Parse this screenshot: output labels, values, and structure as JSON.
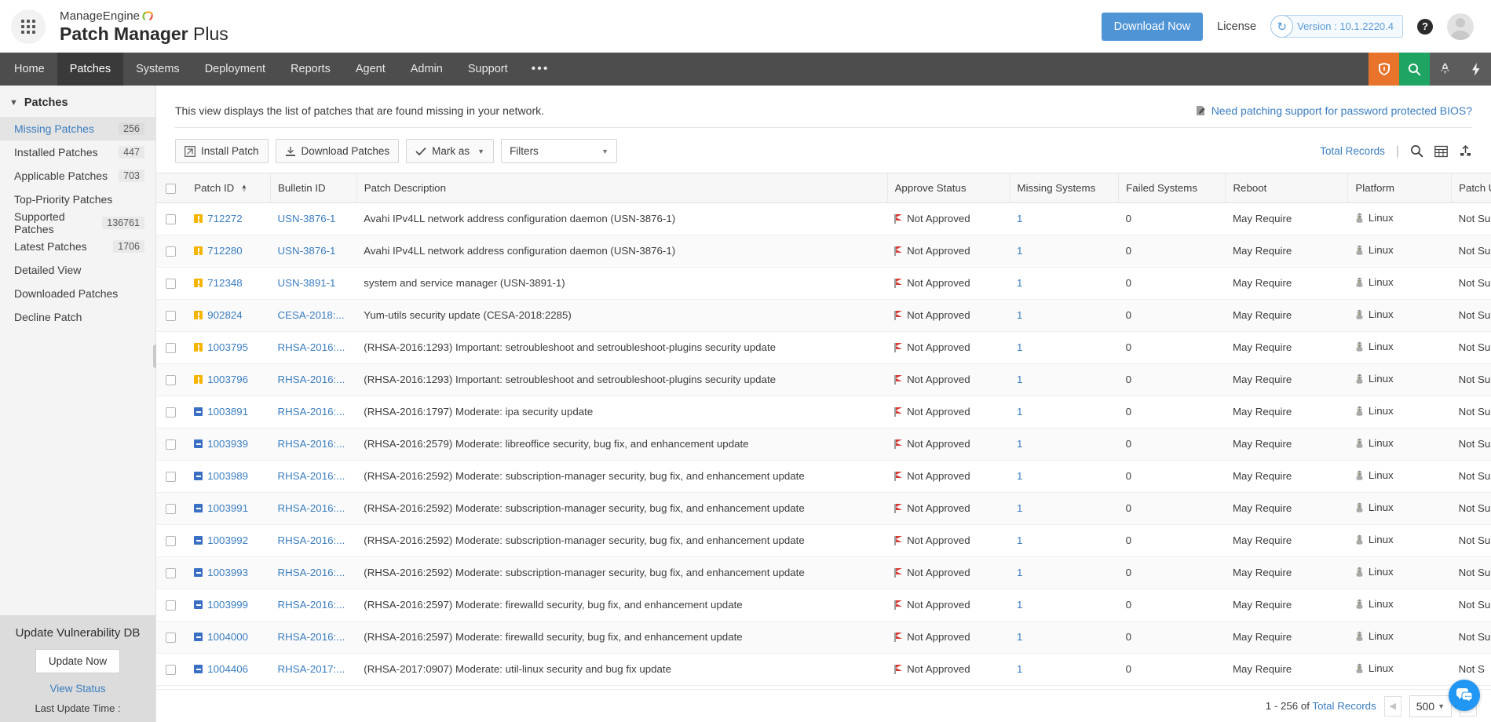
{
  "header": {
    "brand_line1": "ManageEngine",
    "brand_bold": "Patch Manager",
    "brand_light": " Plus",
    "download_now": "Download Now",
    "license": "License",
    "version": "Version : 10.1.2220.4",
    "help": "?"
  },
  "nav": {
    "items": [
      {
        "label": "Home",
        "active": false
      },
      {
        "label": "Patches",
        "active": true
      },
      {
        "label": "Systems",
        "active": false
      },
      {
        "label": "Deployment",
        "active": false
      },
      {
        "label": "Reports",
        "active": false
      },
      {
        "label": "Agent",
        "active": false
      },
      {
        "label": "Admin",
        "active": false
      },
      {
        "label": "Support",
        "active": false
      }
    ],
    "more": "•••",
    "right_icons": [
      "shield-icon",
      "search-icon",
      "rocket-icon",
      "bolt-icon"
    ]
  },
  "sidebar": {
    "title": "Patches",
    "items": [
      {
        "label": "Missing Patches",
        "count": "256",
        "active": true
      },
      {
        "label": "Installed Patches",
        "count": "447",
        "active": false
      },
      {
        "label": "Applicable Patches",
        "count": "703",
        "active": false
      },
      {
        "label": "Top-Priority Patches",
        "count": "",
        "active": false
      },
      {
        "label": "Supported Patches",
        "count": "136761",
        "active": false
      },
      {
        "label": "Latest Patches",
        "count": "1706",
        "active": false
      },
      {
        "label": "Detailed View",
        "count": "",
        "active": false
      },
      {
        "label": "Downloaded Patches",
        "count": "",
        "active": false
      },
      {
        "label": "Decline Patch",
        "count": "",
        "active": false
      }
    ],
    "vuln": {
      "title": "Update Vulnerability DB",
      "update_now": "Update Now",
      "view_status": "View Status",
      "last_update": "Last Update Time :"
    }
  },
  "content": {
    "view_description": "This view displays the list of patches that are found missing in your network.",
    "bios_link": "Need patching support for password protected BIOS?",
    "toolbar": {
      "install_patch": "Install Patch",
      "download_patches": "Download Patches",
      "mark_as": "Mark as",
      "filters": "Filters",
      "total_records": "Total Records"
    },
    "columns": [
      "Patch ID",
      "Bulletin ID",
      "Patch Description",
      "Approve Status",
      "Missing Systems",
      "Failed Systems",
      "Reboot",
      "Platform",
      "Patch Unins"
    ],
    "rows": [
      {
        "sev": "warn",
        "patch_id": "712272",
        "bulletin": "USN-3876-1",
        "desc": "Avahi IPv4LL network address configuration daemon (USN-3876-1)",
        "approve": "Not Approved",
        "missing": "1",
        "failed": "0",
        "reboot": "May Require",
        "platform": "Linux",
        "uninstall": "Not Suppo"
      },
      {
        "sev": "warn",
        "patch_id": "712280",
        "bulletin": "USN-3876-1",
        "desc": "Avahi IPv4LL network address configuration daemon (USN-3876-1)",
        "approve": "Not Approved",
        "missing": "1",
        "failed": "0",
        "reboot": "May Require",
        "platform": "Linux",
        "uninstall": "Not Suppo"
      },
      {
        "sev": "warn",
        "patch_id": "712348",
        "bulletin": "USN-3891-1",
        "desc": "system and service manager (USN-3891-1)",
        "approve": "Not Approved",
        "missing": "1",
        "failed": "0",
        "reboot": "May Require",
        "platform": "Linux",
        "uninstall": "Not Suppo"
      },
      {
        "sev": "warn",
        "patch_id": "902824",
        "bulletin": "CESA-2018:...",
        "desc": "Yum-utils security update (CESA-2018:2285)",
        "approve": "Not Approved",
        "missing": "1",
        "failed": "0",
        "reboot": "May Require",
        "platform": "Linux",
        "uninstall": "Not Suppo"
      },
      {
        "sev": "warn",
        "patch_id": "1003795",
        "bulletin": "RHSA-2016:...",
        "desc": "(RHSA-2016:1293) Important: setroubleshoot and setroubleshoot-plugins security update",
        "approve": "Not Approved",
        "missing": "1",
        "failed": "0",
        "reboot": "May Require",
        "platform": "Linux",
        "uninstall": "Not Suppo"
      },
      {
        "sev": "warn",
        "patch_id": "1003796",
        "bulletin": "RHSA-2016:...",
        "desc": "(RHSA-2016:1293) Important: setroubleshoot and setroubleshoot-plugins security update",
        "approve": "Not Approved",
        "missing": "1",
        "failed": "0",
        "reboot": "May Require",
        "platform": "Linux",
        "uninstall": "Not Suppo"
      },
      {
        "sev": "info",
        "patch_id": "1003891",
        "bulletin": "RHSA-2016:...",
        "desc": "(RHSA-2016:1797) Moderate: ipa security update",
        "approve": "Not Approved",
        "missing": "1",
        "failed": "0",
        "reboot": "May Require",
        "platform": "Linux",
        "uninstall": "Not Suppo"
      },
      {
        "sev": "info",
        "patch_id": "1003939",
        "bulletin": "RHSA-2016:...",
        "desc": "(RHSA-2016:2579) Moderate: libreoffice security, bug fix, and enhancement update",
        "approve": "Not Approved",
        "missing": "1",
        "failed": "0",
        "reboot": "May Require",
        "platform": "Linux",
        "uninstall": "Not Suppo"
      },
      {
        "sev": "info",
        "patch_id": "1003989",
        "bulletin": "RHSA-2016:...",
        "desc": "(RHSA-2016:2592) Moderate: subscription-manager security, bug fix, and enhancement update",
        "approve": "Not Approved",
        "missing": "1",
        "failed": "0",
        "reboot": "May Require",
        "platform": "Linux",
        "uninstall": "Not Suppo"
      },
      {
        "sev": "info",
        "patch_id": "1003991",
        "bulletin": "RHSA-2016:...",
        "desc": "(RHSA-2016:2592) Moderate: subscription-manager security, bug fix, and enhancement update",
        "approve": "Not Approved",
        "missing": "1",
        "failed": "0",
        "reboot": "May Require",
        "platform": "Linux",
        "uninstall": "Not Suppo"
      },
      {
        "sev": "info",
        "patch_id": "1003992",
        "bulletin": "RHSA-2016:...",
        "desc": "(RHSA-2016:2592) Moderate: subscription-manager security, bug fix, and enhancement update",
        "approve": "Not Approved",
        "missing": "1",
        "failed": "0",
        "reboot": "May Require",
        "platform": "Linux",
        "uninstall": "Not Suppo"
      },
      {
        "sev": "info",
        "patch_id": "1003993",
        "bulletin": "RHSA-2016:...",
        "desc": "(RHSA-2016:2592) Moderate: subscription-manager security, bug fix, and enhancement update",
        "approve": "Not Approved",
        "missing": "1",
        "failed": "0",
        "reboot": "May Require",
        "platform": "Linux",
        "uninstall": "Not Suppo"
      },
      {
        "sev": "info",
        "patch_id": "1003999",
        "bulletin": "RHSA-2016:...",
        "desc": "(RHSA-2016:2597) Moderate: firewalld security, bug fix, and enhancement update",
        "approve": "Not Approved",
        "missing": "1",
        "failed": "0",
        "reboot": "May Require",
        "platform": "Linux",
        "uninstall": "Not Suppo"
      },
      {
        "sev": "info",
        "patch_id": "1004000",
        "bulletin": "RHSA-2016:...",
        "desc": "(RHSA-2016:2597) Moderate: firewalld security, bug fix, and enhancement update",
        "approve": "Not Approved",
        "missing": "1",
        "failed": "0",
        "reboot": "May Require",
        "platform": "Linux",
        "uninstall": "Not Suppo"
      },
      {
        "sev": "info",
        "patch_id": "1004406",
        "bulletin": "RHSA-2017:...",
        "desc": "(RHSA-2017:0907) Moderate: util-linux security and bug fix update",
        "approve": "Not Approved",
        "missing": "1",
        "failed": "0",
        "reboot": "May Require",
        "platform": "Linux",
        "uninstall": "Not S"
      }
    ]
  },
  "footer": {
    "range_prefix": "1 - 256 of ",
    "total_records": "Total Records",
    "page_size": "500"
  },
  "colors": {
    "accent_blue": "#3b7dbf",
    "primary_button": "#4f94d4",
    "nav_bar": "#4d4d4d",
    "severity_warning": "#f5b400",
    "severity_info": "#3b6fc4",
    "flag_red": "#d63b36"
  }
}
